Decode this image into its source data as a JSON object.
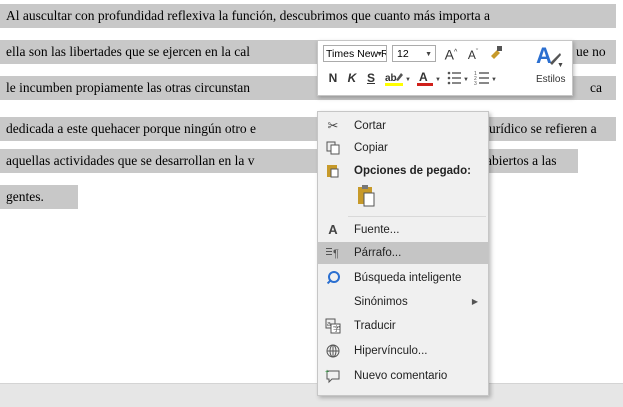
{
  "document": {
    "lines": [
      "Al auscultar con profundidad reflexiva la función, descubrimos que cuanto más importa a",
      "ella son las libertades que se ejercen en la cal",
      "le incumben propiamente las otras circunstan",
      "dedicada a este quehacer porque ningún otro e",
      "aquellas actividades que se desarrollan en la v",
      "gentes."
    ],
    "right_fragments": [
      {
        "line": 1,
        "text": "ue no"
      },
      {
        "line": 2,
        "text": "ca"
      },
      {
        "line": 3,
        "text": "urídico se refieren a"
      },
      {
        "line": 4,
        "text": "abiertos a las"
      }
    ]
  },
  "minitoolbar": {
    "font_name": "Times New Rc",
    "font_size": "12",
    "grow_font": "A",
    "shrink_font": "A",
    "bold": "N",
    "italic": "K",
    "underline": "S",
    "font_color": "A",
    "styles_label": "Estilos"
  },
  "context_menu": {
    "items": [
      {
        "id": "cut",
        "icon": "scissors-icon",
        "label": "Cortar"
      },
      {
        "id": "copy",
        "icon": "copy-icon",
        "label": "Copiar"
      },
      {
        "id": "paste-header",
        "icon": "clipboard-icon",
        "label": "Opciones de pegado:"
      },
      {
        "id": "font",
        "icon": "font-icon",
        "label": "Fuente..."
      },
      {
        "id": "paragraph",
        "icon": "paragraph-icon",
        "label": "Párrafo..."
      },
      {
        "id": "smart-lookup",
        "icon": "search-icon",
        "label": "Búsqueda inteligente"
      },
      {
        "id": "synonyms",
        "icon": "",
        "label": "Sinónimos"
      },
      {
        "id": "translate",
        "icon": "translate-icon",
        "label": "Traducir"
      },
      {
        "id": "hyperlink",
        "icon": "link-icon",
        "label": "Hipervínculo..."
      },
      {
        "id": "new-comment",
        "icon": "comment-icon",
        "label": "Nuevo comentario"
      }
    ]
  },
  "colors": {
    "selection": "#c8c8c8",
    "menu_background": "#f0f0f0",
    "menu_highlight": "#c5c5c5",
    "accent_blue": "#2b6fd0"
  }
}
